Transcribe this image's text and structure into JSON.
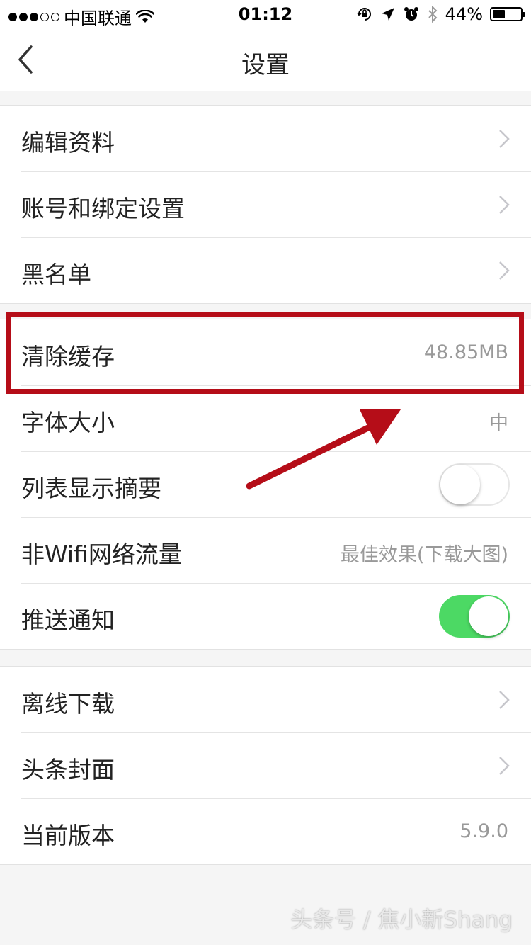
{
  "status_bar": {
    "carrier": "中国联通",
    "time": "01:12",
    "battery": "44%",
    "battery_level": 0.44,
    "signal_bars": 3,
    "signal_total": 5
  },
  "nav": {
    "title": "设置",
    "back_icon": "chevron-left-icon"
  },
  "group1": [
    {
      "label": "编辑资料"
    },
    {
      "label": "账号和绑定设置"
    },
    {
      "label": "黑名单"
    }
  ],
  "group2": [
    {
      "label": "清除缓存",
      "value": "48.85MB"
    },
    {
      "label": "字体大小",
      "value": "中"
    },
    {
      "label": "列表显示摘要",
      "toggle": false
    },
    {
      "label": "非Wifi网络流量",
      "value": "最佳效果(下载大图)"
    },
    {
      "label": "推送通知",
      "toggle": true
    }
  ],
  "group3": [
    {
      "label": "离线下载"
    },
    {
      "label": "头条封面"
    },
    {
      "label": "当前版本",
      "value": "5.9.0"
    }
  ],
  "annotation": {
    "highlight_color": "#b50d18"
  },
  "watermark": "头条号 / 焦小新Shang",
  "colors": {
    "toggle_on": "#4cd964",
    "background": "#f5f5f5"
  }
}
